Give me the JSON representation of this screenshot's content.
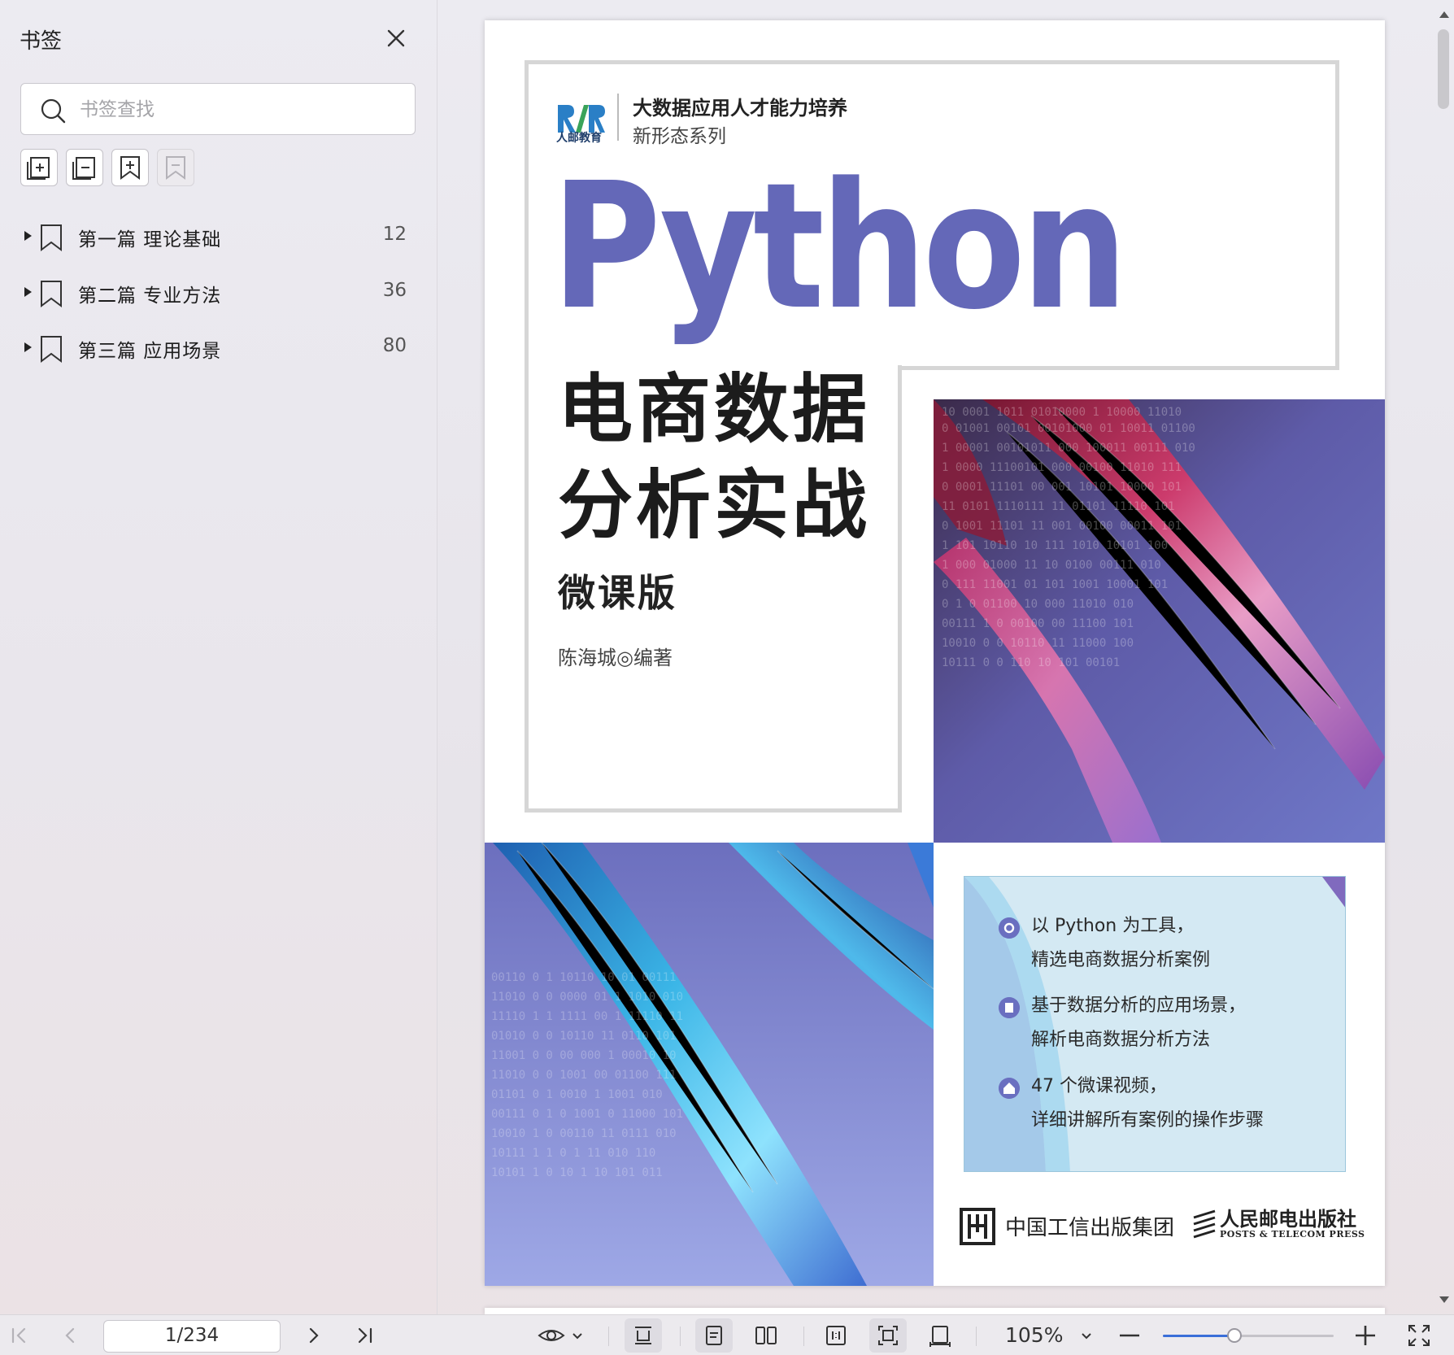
{
  "sidebar": {
    "title": "书签",
    "search_placeholder": "书签查找",
    "tools": [
      "expand-all",
      "collapse-all",
      "add-bookmark",
      "delete-bookmark"
    ],
    "items": [
      {
        "label": "第一篇 理论基础",
        "page": "12"
      },
      {
        "label": "第二篇 专业方法",
        "page": "36"
      },
      {
        "label": "第三篇 应用场景",
        "page": "80"
      }
    ]
  },
  "cover": {
    "logo_text": "人邮教育",
    "series_line1": "大数据应用人才能力培养",
    "series_line2": "新形态系列",
    "title_en": "Python",
    "title_cn_line1": "电商数据",
    "title_cn_line2": "分析实战",
    "edition": "微课版",
    "author": "陈海城◎编著",
    "features": [
      {
        "icon": "gear-icon",
        "line1": "以 Python 为工具，",
        "line2": "精选电商数据分析案例"
      },
      {
        "icon": "book-icon",
        "line1": "基于数据分析的应用场景，",
        "line2": "解析电商数据分析方法"
      },
      {
        "icon": "home-icon",
        "line1": "47 个微课视频，",
        "line2": "详细讲解所有案例的操作步骤"
      }
    ],
    "publisher1": "中国工信出版集团",
    "publisher2": "人民邮电出版社",
    "publisher2_en": "POSTS & TELECOM PRESS",
    "accent_color": "#6468b8"
  },
  "toolbar": {
    "page_indicator": "1/234",
    "zoom": "105%",
    "zoom_level": 0.42
  }
}
